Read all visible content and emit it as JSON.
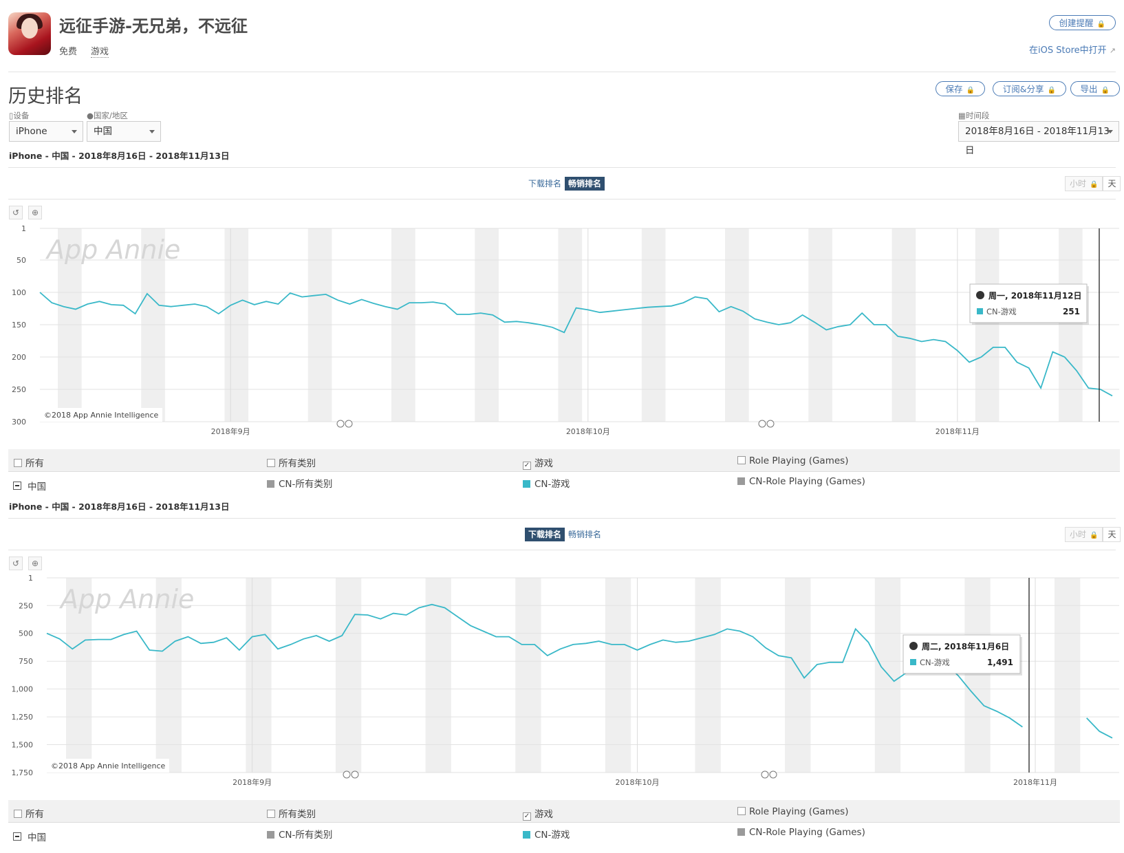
{
  "app": {
    "title": "远征手游-无兄弟，不远征",
    "price": "免费",
    "category": "游戏",
    "create_alert": "创建提醒",
    "open_ios": "在iOS Store中打开"
  },
  "page": {
    "title": "历史排名",
    "save": "保存",
    "subscribe": "订阅&分享",
    "export": "导出",
    "device_label": "设备",
    "device_value": "iPhone",
    "country_label": "国家/地区",
    "country_value": "中国",
    "period_label": "时间段",
    "period_value": "2018年8月16日 - 2018年11月13日"
  },
  "legend_items": {
    "all": "所有",
    "all_categories": "所有类别",
    "games": "游戏",
    "role_playing": "Role Playing (Games)",
    "country": "中国",
    "cn_all": "CN-所有类别",
    "cn_games": "CN-游戏",
    "cn_rpg": "CN-Role Playing (Games)"
  },
  "colors": {
    "series": "#39b8c8",
    "tab_active": "#2f4f6f",
    "link": "#4a7ab5",
    "weekend_band": "#efefef",
    "swatch_gray": "#9a9a9a"
  },
  "charts": [
    {
      "caption": "iPhone - 中国 - 2018年8月16日 - 2018年11月13日",
      "tabs": [
        "下载排名",
        "畅销排名"
      ],
      "active_tab": 1,
      "hour_label": "小时",
      "day_label": "天",
      "watermark": "App Annie",
      "copyright": "©2018 App Annie Intelligence",
      "tooltip": {
        "date": "周一, 2018年11月12日",
        "series": "CN-游戏",
        "value": "251"
      },
      "chart_data": {
        "type": "line",
        "x_start": "2018-08-16",
        "x_tick_labels": [
          "2018年9月",
          "2018年10月",
          "2018年11月"
        ],
        "y_tick_labels": [
          "1",
          "50",
          "100",
          "150",
          "200",
          "250",
          "300"
        ],
        "ylim": [
          1,
          300
        ],
        "y_inverted": true,
        "series": [
          {
            "name": "CN-游戏",
            "values": [
              100,
              116,
              122,
              126,
              118,
              114,
              119,
              120,
              133,
              102,
              120,
              122,
              120,
              118,
              122,
              133,
              120,
              112,
              119,
              114,
              118,
              101,
              107,
              105,
              103,
              112,
              118,
              111,
              117,
              122,
              126,
              116,
              116,
              115,
              118,
              134,
              134,
              132,
              135,
              146,
              145,
              147,
              150,
              154,
              162,
              124,
              127,
              131,
              129,
              127,
              125,
              123,
              122,
              121,
              116,
              107,
              110,
              130,
              122,
              129,
              141,
              146,
              150,
              147,
              135,
              146,
              158,
              153,
              150,
              132,
              150,
              150,
              168,
              171,
              176,
              173,
              176,
              190,
              208,
              200,
              185,
              185,
              208,
              217,
              248,
              192,
              200,
              221,
              248,
              250,
              260
            ]
          }
        ]
      }
    },
    {
      "caption": "iPhone - 中国 - 2018年8月16日 - 2018年11月13日",
      "tabs": [
        "下载排名",
        "畅销排名"
      ],
      "active_tab": 0,
      "hour_label": "小时",
      "day_label": "天",
      "watermark": "App Annie",
      "copyright": "©2018 App Annie Intelligence",
      "tooltip": {
        "date": "周二, 2018年11月6日",
        "series": "CN-游戏",
        "value": "1,491"
      },
      "chart_data": {
        "type": "line",
        "x_start": "2018-08-16",
        "x_tick_labels": [
          "2018年9月",
          "2018年10月",
          "2018年11月"
        ],
        "y_tick_labels": [
          "1",
          "250",
          "500",
          "750",
          "1,000",
          "1,250",
          "1,500",
          "1,750"
        ],
        "ylim": [
          1,
          1750
        ],
        "y_inverted": true,
        "series": [
          {
            "name": "CN-游戏",
            "values": [
              500,
              550,
              640,
              560,
              555,
              555,
              510,
              480,
              650,
              660,
              570,
              530,
              590,
              580,
              540,
              650,
              530,
              510,
              640,
              600,
              550,
              520,
              570,
              520,
              330,
              335,
              370,
              320,
              335,
              270,
              240,
              270,
              350,
              430,
              480,
              530,
              530,
              600,
              600,
              700,
              640,
              600,
              590,
              570,
              600,
              600,
              650,
              600,
              560,
              580,
              570,
              540,
              510,
              460,
              480,
              530,
              630,
              700,
              720,
              900,
              780,
              760,
              760,
              460,
              580,
              800,
              930,
              850,
              750,
              770,
              770,
              880,
              1020,
              1150,
              1200,
              1260,
              1340,
              null,
              null,
              null,
              null,
              1260,
              1380,
              1440
            ]
          }
        ]
      }
    }
  ]
}
